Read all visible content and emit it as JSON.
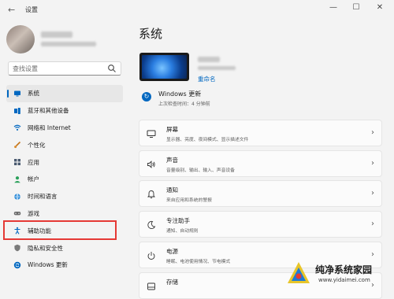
{
  "window": {
    "title": "设置",
    "back_icon": "back-arrow-icon"
  },
  "search": {
    "placeholder": "查找设置"
  },
  "nav": {
    "items": [
      {
        "label": "系统",
        "icon": "display-icon",
        "color": "#0067c0",
        "selected": true
      },
      {
        "label": "蓝牙和其他设备",
        "icon": "bluetooth-icon",
        "color": "#0067c0"
      },
      {
        "label": "网络和 Internet",
        "icon": "wifi-icon",
        "color": "#0067c0"
      },
      {
        "label": "个性化",
        "icon": "brush-icon",
        "color": "#c4741a"
      },
      {
        "label": "应用",
        "icon": "apps-icon",
        "color": "#4a5a70"
      },
      {
        "label": "帐户",
        "icon": "person-icon",
        "color": "#2aa05a"
      },
      {
        "label": "时间和语言",
        "icon": "globe-clock-icon",
        "color": "#0067c0"
      },
      {
        "label": "游戏",
        "icon": "gamepad-icon",
        "color": "#6b6b6b"
      },
      {
        "label": "辅助功能",
        "icon": "accessibility-icon",
        "color": "#0067c0"
      },
      {
        "label": "隐私和安全性",
        "icon": "shield-icon",
        "color": "#6b6b6b"
      },
      {
        "label": "Windows 更新",
        "icon": "update-icon",
        "color": "#0067c0"
      }
    ]
  },
  "main": {
    "title": "系统",
    "device": {
      "rename_label": "重命名"
    },
    "update": {
      "title": "Windows 更新",
      "subtitle": "上次检查时间：4 分钟前"
    },
    "cards": [
      {
        "title": "屏幕",
        "subtitle": "显示器、亮度、夜间模式、显示描述文件",
        "icon": "monitor-icon"
      },
      {
        "title": "声音",
        "subtitle": "音量级别、输出、输入、声音设备",
        "icon": "speaker-icon"
      },
      {
        "title": "通知",
        "subtitle": "来自应用和系统的警报",
        "icon": "bell-icon"
      },
      {
        "title": "专注助手",
        "subtitle": "通知、自动规则",
        "icon": "moon-icon"
      },
      {
        "title": "电源",
        "subtitle": "睡眠、电池使用情况、节电模式",
        "icon": "power-icon"
      },
      {
        "title": "存储",
        "subtitle": "",
        "icon": "storage-icon"
      }
    ]
  },
  "watermark": {
    "text": "纯净系统家园",
    "url": "www.yidaimei.com"
  },
  "colors": {
    "accent": "#0067c0",
    "highlight": "#e53935"
  }
}
